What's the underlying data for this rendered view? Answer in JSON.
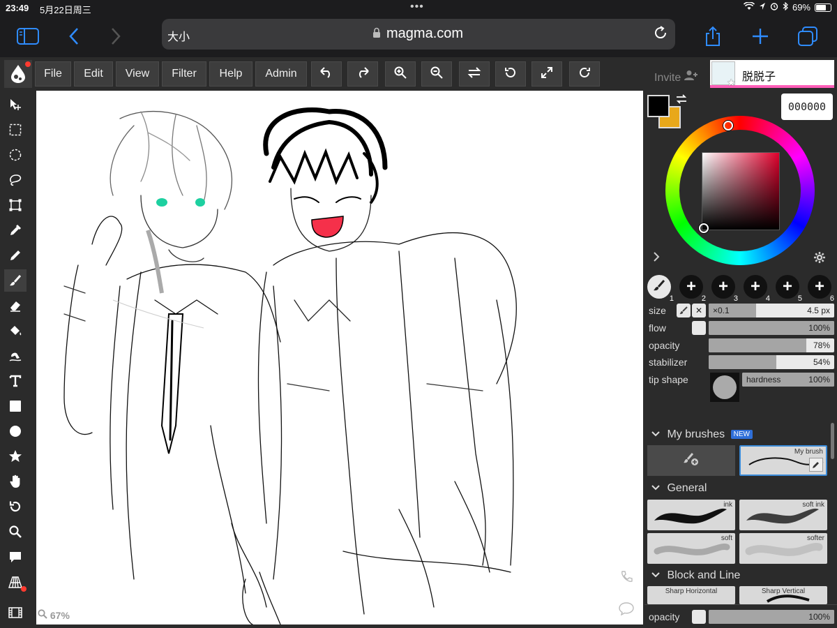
{
  "status_bar": {
    "time": "23:49",
    "date": "5月22日周三",
    "battery": "69%"
  },
  "browser": {
    "text_size": "大小",
    "url": "magma.com"
  },
  "menu": {
    "file": "File",
    "edit": "Edit",
    "view": "View",
    "filter": "Filter",
    "help": "Help",
    "admin": "Admin"
  },
  "canvas": {
    "zoom": "67%"
  },
  "panel": {
    "invite": "Invite",
    "username": "脱脱子",
    "hex": "000000",
    "colors": {
      "primary": "#000000",
      "secondary": "#e8a81a",
      "accent": "#ff5eb8"
    },
    "brush_slots": [
      "1",
      "2",
      "3",
      "4",
      "5",
      "6"
    ],
    "size": {
      "label": "size",
      "multiplier": "×0.1",
      "value": "4.5 px"
    },
    "flow": {
      "label": "flow",
      "value": "100%",
      "level": 1.0
    },
    "opacity": {
      "label": "opacity",
      "value": "78%",
      "level": 0.78
    },
    "stabilizer": {
      "label": "stabilizer",
      "value": "54%",
      "level": 0.54
    },
    "tip_shape": {
      "label": "tip shape",
      "hardness_label": "hardness",
      "hardness_value": "100%"
    },
    "my_brushes": {
      "title": "My brushes",
      "badge": "NEW",
      "brush_name": "My brush"
    },
    "general": {
      "title": "General",
      "brushes": [
        "ink",
        "soft ink",
        "soft",
        "softer"
      ]
    },
    "block_and_line": {
      "title": "Block and Line",
      "brushes": [
        "Sharp Horizontal",
        "Sharp Vertical"
      ]
    },
    "layer_opacity": {
      "label": "opacity",
      "value": "100%"
    }
  }
}
